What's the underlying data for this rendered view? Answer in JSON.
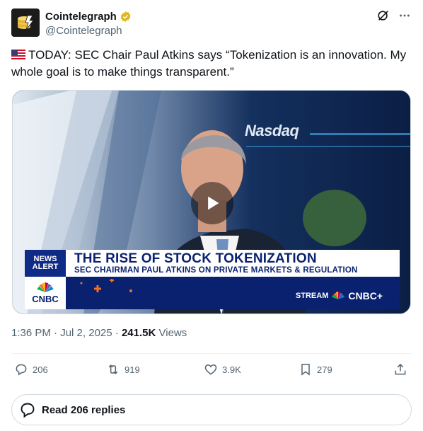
{
  "author": {
    "display_name": "Cointelegraph",
    "handle": "@Cointelegraph",
    "verified_color": "#e2b719"
  },
  "tweet": {
    "text": "TODAY: SEC Chair Paul Atkins says “Tokenization is an innovation. My whole goal is to make things transparent.”",
    "flag": "US flag"
  },
  "video": {
    "news_alert_line1": "NEWS",
    "news_alert_line2": "ALERT",
    "network": "CNBC",
    "headline": "THE RISE OF STOCK TOKENIZATION",
    "subhead": "SEC CHAIRMAN PAUL ATKINS ON PRIVATE MARKETS & REGULATION",
    "stream_label": "STREAM",
    "stream_brand": "CNBC+",
    "background_sign": "Nasdaq"
  },
  "meta": {
    "time": "1:36 PM",
    "date": "Jul 2, 2025",
    "views_count": "241.5K",
    "views_label": "Views"
  },
  "actions": {
    "replies": "206",
    "reposts": "919",
    "likes": "3.9K",
    "bookmarks": "279"
  },
  "read_replies_label": "Read 206 replies",
  "colors": {
    "text": "#0f1419",
    "secondary": "#536471",
    "cnbc_blue": "#0a2170"
  }
}
